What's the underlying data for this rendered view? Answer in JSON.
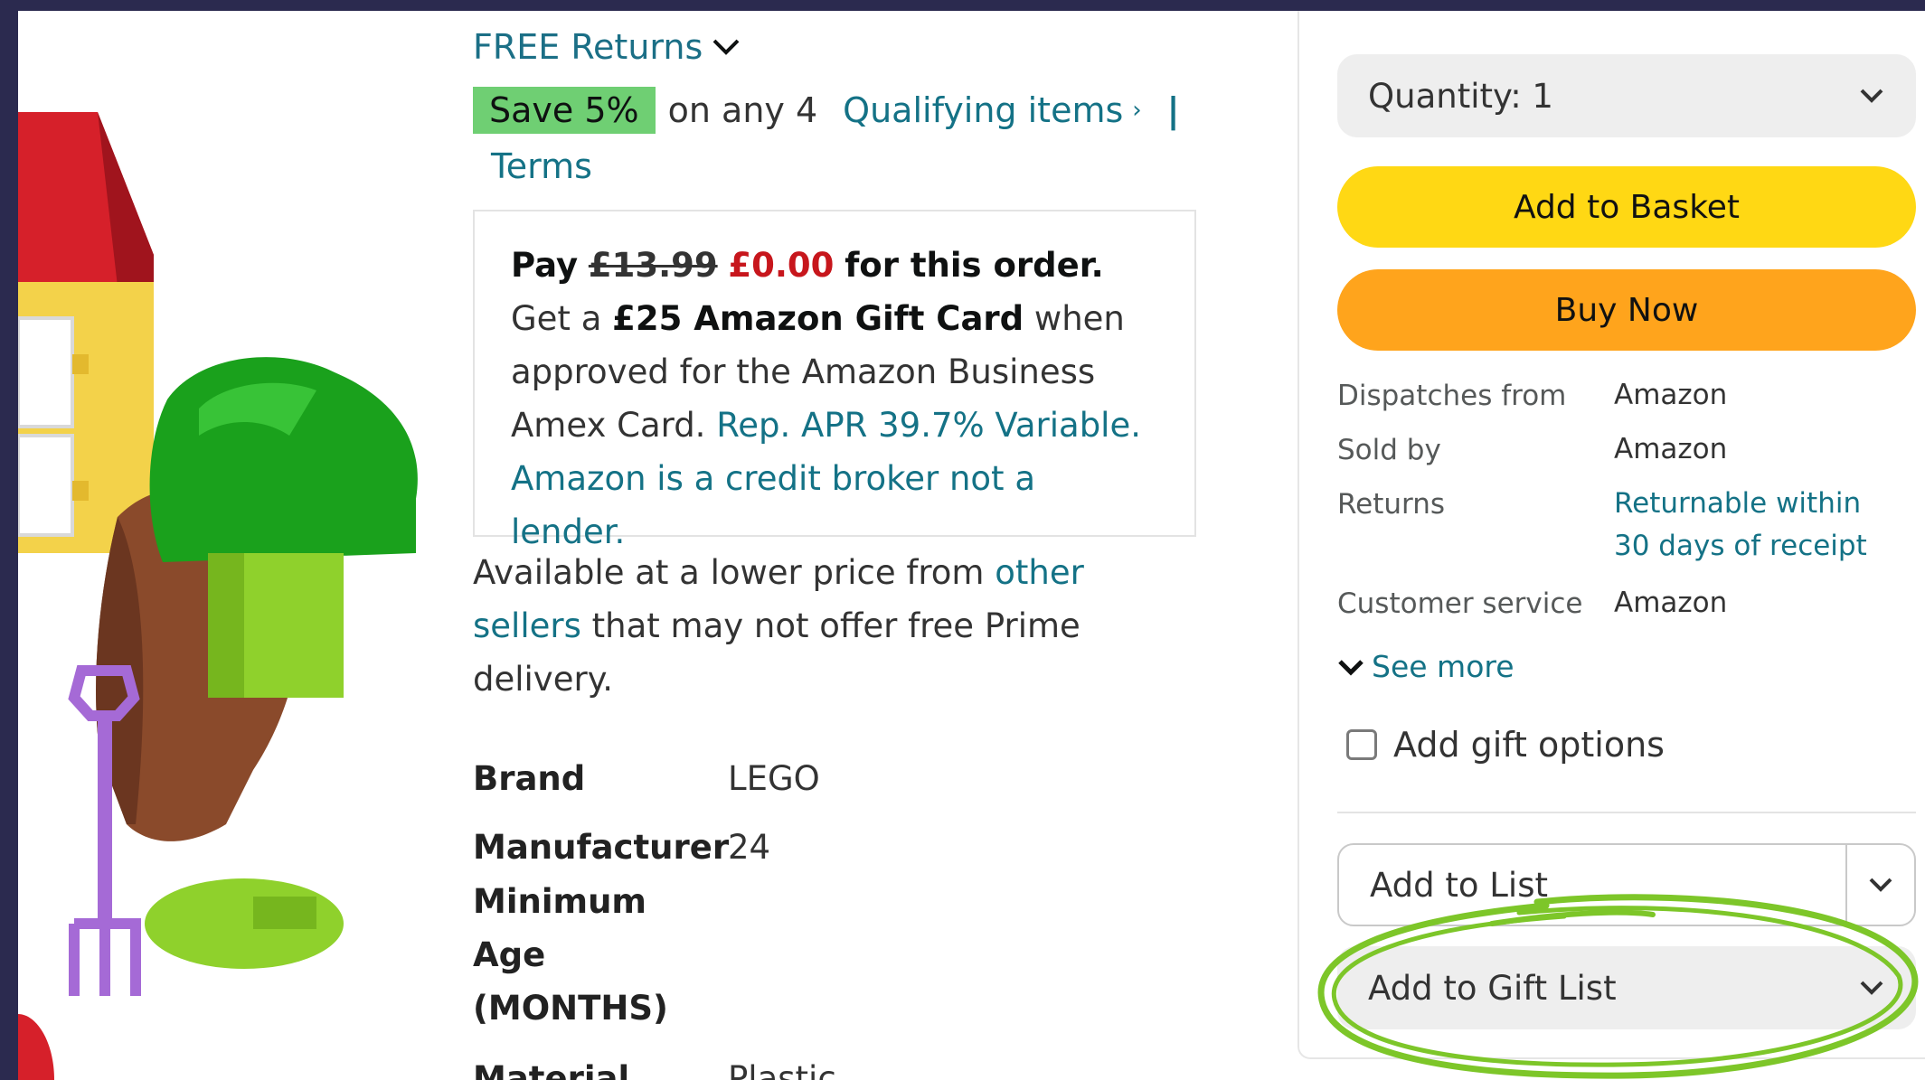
{
  "colors": {
    "accent_link": "#147286",
    "save_badge": "#6fcf73",
    "price_red": "#c7161c",
    "basket_button": "#ffd814",
    "buy_button": "#ffa41c",
    "annotation": "#7dc629"
  },
  "shipping": {
    "free_returns": "FREE Returns"
  },
  "promo": {
    "badge": "Save 5%",
    "text": "on any 4",
    "link": "Qualifying items",
    "separator": "|",
    "terms": "Terms"
  },
  "offer": {
    "pay": "Pay",
    "old_price": "£13.99",
    "new_price": "£0.00",
    "for_order": "for this order.",
    "get_a": " Get a ",
    "gift_card": "£25 Amazon Gift Card",
    "when": " when approved for the Amazon Business Amex Card. ",
    "apr_link": "Rep. APR 39.7% Variable. Amazon is a credit broker not a lender."
  },
  "lower_price": {
    "pre": "Available at a lower price from ",
    "link": "other sellers",
    "post": " that may not offer free Prime delivery."
  },
  "specs": [
    {
      "label": "Brand",
      "value": "LEGO"
    },
    {
      "label": "Manufacturer",
      "value": "24"
    },
    {
      "label": "Minimum Age (MONTHS)",
      "value": ""
    },
    {
      "label": "Material",
      "value": "Plastic"
    }
  ],
  "buybox": {
    "quantity_label": "Quantity: 1",
    "add_to_basket": "Add to Basket",
    "buy_now": "Buy Now",
    "info": [
      {
        "label": "Dispatches from",
        "value": "Amazon"
      },
      {
        "label": "Sold by",
        "value": "Amazon"
      },
      {
        "label": "Returns",
        "value": "Returnable within 30 days of receipt"
      },
      {
        "label": "Customer service",
        "value": "Amazon"
      }
    ],
    "see_more": "See more",
    "gift_options": "Add gift options",
    "add_to_list": "Add to List",
    "add_to_gift_list": "Add to Gift List"
  }
}
